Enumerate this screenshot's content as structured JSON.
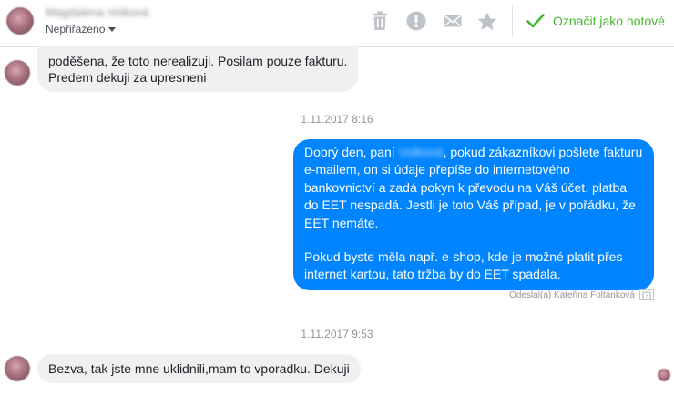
{
  "header": {
    "contact_name": "Magdalena Volková",
    "assignment": "Nepřiřazeno",
    "toolbar": {
      "delete_icon": "trash-icon",
      "spam_icon": "exclamation-icon",
      "unread_icon": "envelope-icon",
      "star_icon": "star-icon"
    },
    "done_label": "Označit jako hotové",
    "done_color": "#42b72a"
  },
  "messages": [
    {
      "direction": "incoming",
      "lines": [
        "poděšena, že toto nerealizuji. Posilam pouze fakturu.",
        "Predem dekuji za upresneni"
      ]
    },
    {
      "timestamp": "1.11.2017 8:16"
    },
    {
      "direction": "outgoing",
      "greeting_start": "Dobrý den, paní ",
      "redacted_name": "Volková",
      "greeting_end": ", pokud zákazníkovi pošlete fakturu e-mailem, on si údaje přepíše do internetového bankovnictví a zadá pokyn k převodu na Váš účet, platba do EET nespadá. Jestli je toto Váš případ, je v pořádku, že EET nemáte.",
      "paragraph2": "Pokud byste měla např. e-shop, kde je možné platit přes internet kartou, tato tržba by do EET spadala.",
      "sent_by": "Odeslal(a) Kateřina Foltánková",
      "help": "[?]",
      "bubble_color": "#0084ff"
    },
    {
      "timestamp": "1.11.2017 9:53"
    },
    {
      "direction": "incoming",
      "text": "Bezva, tak jste mne uklidnili,mam to vporadku. Dekuji"
    }
  ]
}
